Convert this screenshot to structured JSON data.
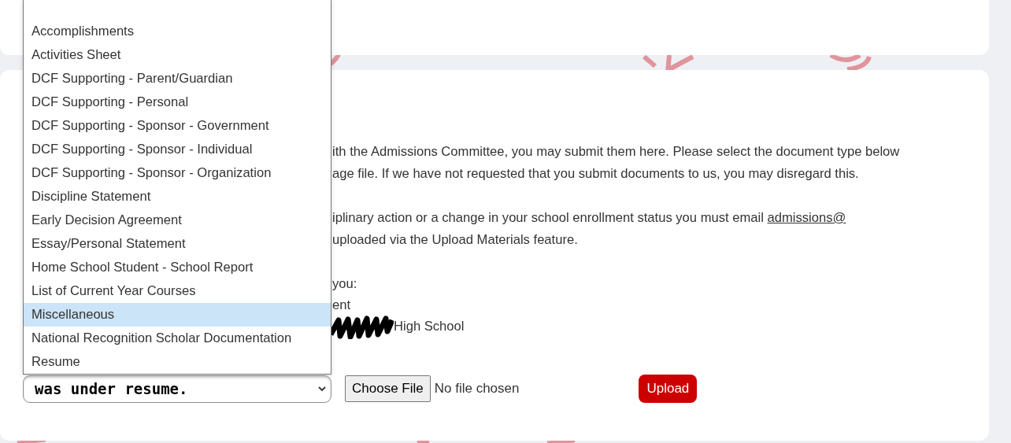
{
  "document_type_list": [
    {
      "label": "Accomplishments",
      "selected": false
    },
    {
      "label": "Activities Sheet",
      "selected": false
    },
    {
      "label": "DCF Supporting - Parent/Guardian",
      "selected": false
    },
    {
      "label": "DCF Supporting - Personal",
      "selected": false
    },
    {
      "label": "DCF Supporting - Sponsor - Government",
      "selected": false
    },
    {
      "label": "DCF Supporting - Sponsor - Individual",
      "selected": false
    },
    {
      "label": "DCF Supporting - Sponsor - Organization",
      "selected": false
    },
    {
      "label": "Discipline Statement",
      "selected": false
    },
    {
      "label": "Early Decision Agreement",
      "selected": false
    },
    {
      "label": "Essay/Personal Statement",
      "selected": false
    },
    {
      "label": "Home School Student - School Report",
      "selected": false
    },
    {
      "label": "List of Current Year Courses",
      "selected": false
    },
    {
      "label": "Miscellaneous",
      "selected": true
    },
    {
      "label": "National Recognition Scholar Documentation",
      "selected": false
    },
    {
      "label": "Resume",
      "selected": false
    }
  ],
  "instruction_paragraphs": [
    {
      "lines": [
        {
          "text": "ith the Admissions Committee, you may submit them here. Please select the document type below"
        },
        {
          "text": "age file. If we have not requested that you submit documents to us, you may disregard this."
        }
      ]
    },
    {
      "lines": [
        {
          "text": "iplinary action or a change in your school enrollment status you must email ",
          "link": "admissions@"
        },
        {
          "text": "uploaded via the Upload Materials feature."
        }
      ]
    },
    {
      "lines": [
        {
          "text": "you:"
        },
        {
          "text": "ent"
        },
        {
          "text": "High School",
          "redacted_prefix": true
        }
      ]
    }
  ],
  "upload_form": {
    "select_value": "was under resume.",
    "file_button": "Choose File",
    "file_status": "No file chosen",
    "upload_button": "Upload"
  }
}
